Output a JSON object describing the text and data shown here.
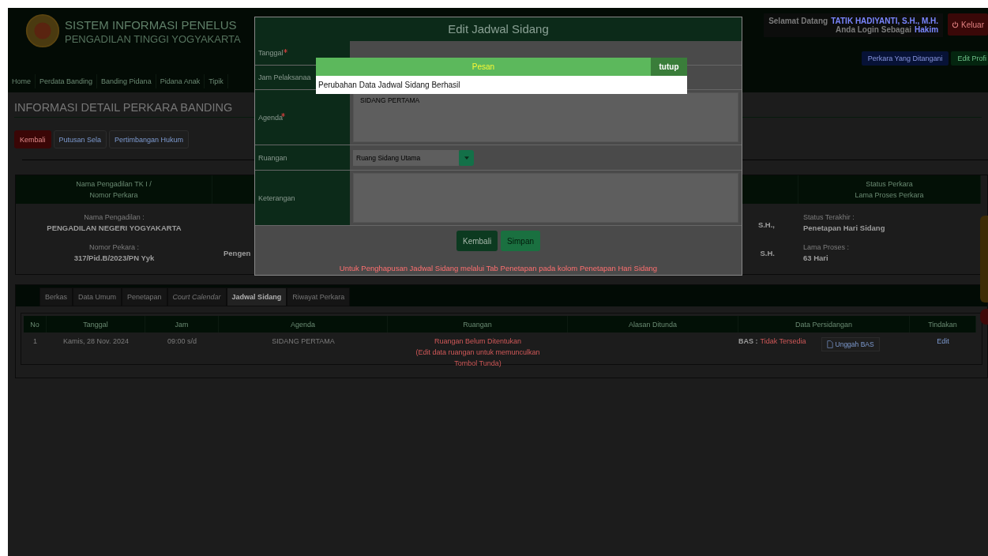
{
  "header": {
    "title": "SISTEM INFORMASI PENELUS",
    "subtitle": "PENGADILAN TINGGI YOGYAKARTA",
    "welcome_label": "Selamat Datang",
    "user_name": "TATIK HADIYANTI, S.H., M.H.",
    "role_label": "Anda Login Sebagai",
    "role": "Hakim",
    "logout": "Keluar",
    "buttons": [
      {
        "label": "Perkara Yang Ditangani",
        "kind": "primary"
      },
      {
        "label": "Edit Profi",
        "kind": "success"
      }
    ]
  },
  "nav": [
    "Home",
    "Perdata Banding",
    "Banding Pidana",
    "Pidana Anak",
    "Tipik"
  ],
  "page_title": "INFORMASI DETAIL PERKARA BANDING",
  "actions": [
    {
      "label": "Kembali",
      "kind": "danger"
    },
    {
      "label": "Putusan Sela",
      "kind": "plain"
    },
    {
      "label": "Pertimbangan Hukum",
      "kind": "plain"
    }
  ],
  "info": {
    "headers": [
      [
        "Nama Pengadilan TK I /",
        "Nomor Perkara"
      ],
      [
        "Status Perkara",
        "Lama Proses Perkara"
      ]
    ],
    "court": [
      {
        "label": "Nama Pengadilan :",
        "value": "PENGADILAN NEGERI YOGYAKARTA"
      },
      {
        "label": "Nomor Pekara :",
        "value": "317/Pid.B/2023/PN Yyk"
      }
    ],
    "column_2": "Pengen",
    "column_3": [
      "S.H.,",
      "S.H."
    ],
    "status": [
      {
        "label": "Status Terakhir :",
        "value": "Penetapan Hari Sidang"
      },
      {
        "label": "Lama Proses :",
        "value": "63 Hari"
      }
    ]
  },
  "tabs": [
    {
      "label": "Berkas",
      "selected": false,
      "italic": false
    },
    {
      "label": "Data Umum",
      "selected": false,
      "italic": false
    },
    {
      "label": "Penetapan",
      "selected": false,
      "italic": false
    },
    {
      "label": "Court Calendar",
      "selected": false,
      "italic": true
    },
    {
      "label": "Jadwal Sidang",
      "selected": true,
      "italic": false
    },
    {
      "label": "Riwayat Perkara",
      "selected": false,
      "italic": false
    }
  ],
  "table": {
    "columns": [
      "No",
      "Tanggal",
      "Jam",
      "Agenda",
      "Ruangan",
      "Alasan Ditunda",
      "Data Persidangan",
      "Tindakan"
    ],
    "rows": [
      {
        "no": "1",
        "tanggal": "Kamis, 28 Nov. 2024",
        "jam": "09:00 s/d",
        "agenda": "SIDANG PERTAMA",
        "ruangan": [
          "Ruangan Belum Ditentukan",
          "(Edit data ruangan untuk memunculkan",
          "Tombol Tunda)"
        ],
        "bas_label": "BAS :",
        "bas_status": "Tidak Tersedia",
        "upload": "Unggah BAS",
        "action": "Edit"
      }
    ]
  },
  "modal": {
    "title": "Edit Jadwal Sidang",
    "fields": [
      {
        "label": "Tanggal",
        "required": true,
        "kind": "text"
      },
      {
        "label": "Jam Pelaksanaa",
        "required": false,
        "kind": "text"
      },
      {
        "label": "Agenda",
        "required": true,
        "kind": "textarea",
        "value": "SIDANG PERTAMA"
      },
      {
        "label": "Ruangan",
        "required": false,
        "kind": "select",
        "value": "Ruang Sidang Utama"
      },
      {
        "label": "Keterangan",
        "required": false,
        "kind": "textarea"
      }
    ],
    "buttons": [
      {
        "label": "Kembali",
        "kind": "back"
      },
      {
        "label": "Simpan",
        "kind": "save"
      }
    ],
    "note": "Untuk Penghapusan Jadwal Sidang melalui Tab Penetapan pada kolom Penetapan Hari Sidang"
  },
  "message": {
    "title": "Pesan",
    "close": "tutup",
    "text": "Perubahan Data Jadwal Sidang Berhasil"
  }
}
